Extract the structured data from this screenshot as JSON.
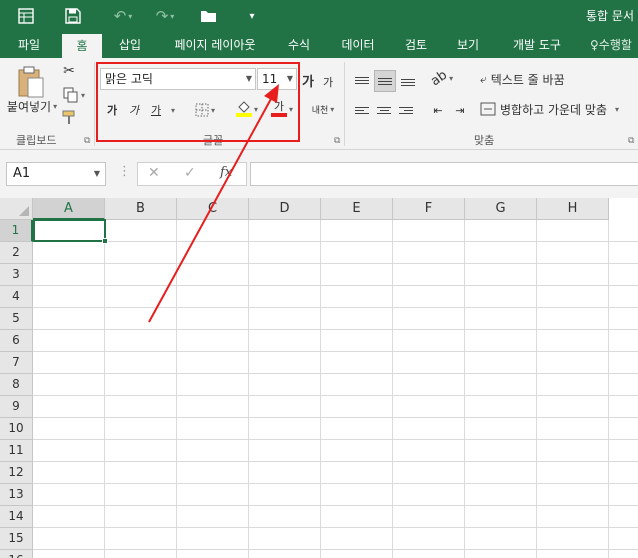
{
  "title_bar": {
    "doc_title": "통합 문서",
    "quick_access": [
      "save-icon",
      "undo-icon",
      "redo-icon",
      "open-folder-icon",
      "customize-icon"
    ],
    "accent": "#217346"
  },
  "tabs": [
    {
      "label": "파일"
    },
    {
      "label": "홈",
      "active": true
    },
    {
      "label": "삽입"
    },
    {
      "label": "페이지 레이아웃"
    },
    {
      "label": "수식"
    },
    {
      "label": "데이터"
    },
    {
      "label": "검토"
    },
    {
      "label": "보기"
    },
    {
      "label": "개발 도구"
    },
    {
      "label": "수행할"
    }
  ],
  "ribbon": {
    "clipboard": {
      "paste_label": "붙여넣기",
      "group_label": "클립보드"
    },
    "font": {
      "font_name": "맑은 고딕",
      "font_size": "11",
      "bold_label": "가",
      "italic_label": "가",
      "underline_label": "가",
      "increase_label": "가",
      "decrease_label": "가",
      "font_color_label": "가",
      "phonetic_label": "내천",
      "group_label": "글꼴",
      "highlight_color": "#e81d1d"
    },
    "alignment": {
      "wrap_label": "텍스트 줄 바꿈",
      "merge_label": "병합하고 가운데 맞춤",
      "group_label": "맞춤"
    }
  },
  "formula_bar": {
    "name_box": "A1",
    "fx_label": "fx",
    "value": ""
  },
  "sheet": {
    "columns": [
      "A",
      "B",
      "C",
      "D",
      "E",
      "F",
      "G",
      "H"
    ],
    "rows": [
      "1",
      "2",
      "3",
      "4",
      "5",
      "6",
      "7",
      "8",
      "9",
      "10",
      "11",
      "12",
      "13",
      "14",
      "15",
      "16"
    ],
    "active_cell": "A1",
    "active_col": "A",
    "active_row": "1"
  },
  "annotation": {
    "color": "#e81d1d"
  }
}
